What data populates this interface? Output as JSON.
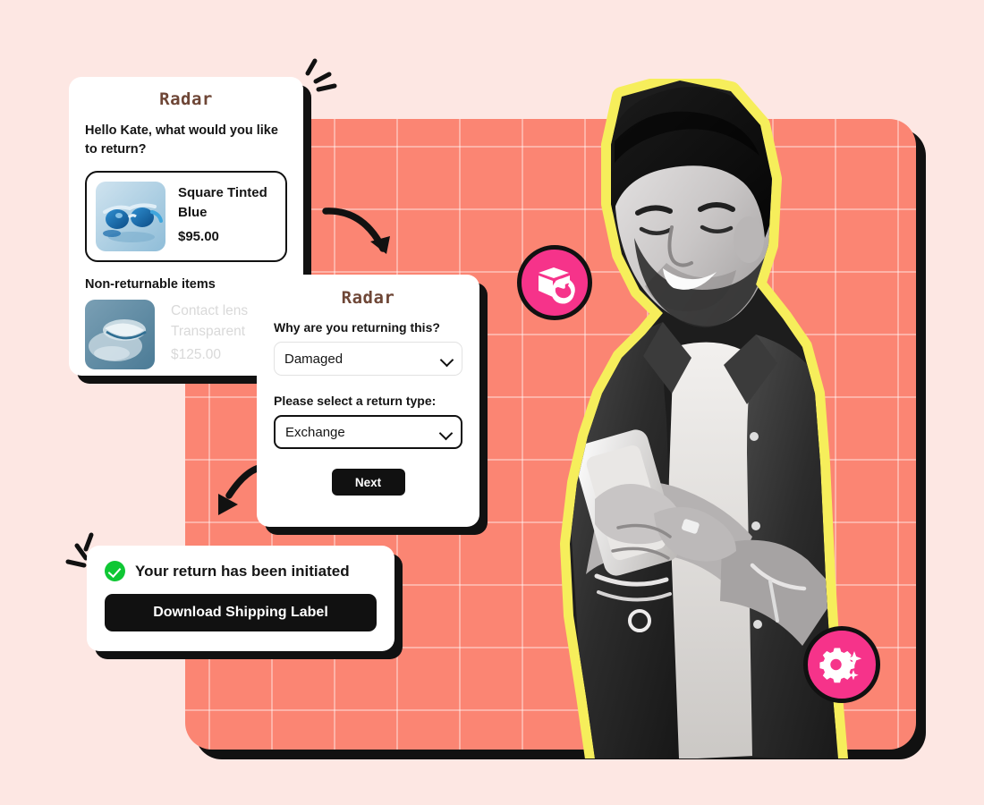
{
  "page": {
    "background_color": "#FDE7E3",
    "panel_color": "#FB8573",
    "accent_pink": "#F6338A",
    "accent_yellow": "#F6EE5B",
    "success_green": "#0FC734",
    "ink": "#111111",
    "brand_brown": "#6E4636"
  },
  "brand": {
    "name": "Radar"
  },
  "card_return_items": {
    "logo": "Radar",
    "prompt": "Hello Kate, what would you like to return?",
    "returnable_item": {
      "thumbnail": "square-tinted-blue-sunglasses-image",
      "name": "Square Tinted Blue",
      "price": "$95.00"
    },
    "non_returnable_heading": "Non-returnable items",
    "non_returnable_item": {
      "thumbnail": "transparent-contact-lens-image",
      "name": "Contact lens Transparent",
      "price": "$125.00"
    }
  },
  "card_return_reason": {
    "logo": "Radar",
    "reason_label": "Why are you returning this?",
    "reason_value": "Damaged",
    "type_label": "Please select a return type:",
    "type_value": "Exchange",
    "next_label": "Next"
  },
  "card_return_confirmed": {
    "status_icon": "check-circle-icon",
    "status_text": "Your return has been initiated",
    "download_label": "Download Shipping Label"
  },
  "badges": [
    {
      "id": "badge-return",
      "icon": "package-return-icon"
    },
    {
      "id": "badge-settings",
      "icon": "gear-sparkle-icon"
    }
  ],
  "photo": {
    "subject": "smiling-man-using-smartphone",
    "treatment": "black-and-white-cutout-with-yellow-outline"
  },
  "decorations": [
    {
      "id": "sparkle-top-right",
      "icon": "sparkle-lines-icon"
    },
    {
      "id": "arrow-down-right",
      "icon": "curved-arrow-icon"
    },
    {
      "id": "arrow-down-left",
      "icon": "curved-arrow-icon"
    },
    {
      "id": "sparkle-bottom-left",
      "icon": "sparkle-lines-icon"
    }
  ]
}
